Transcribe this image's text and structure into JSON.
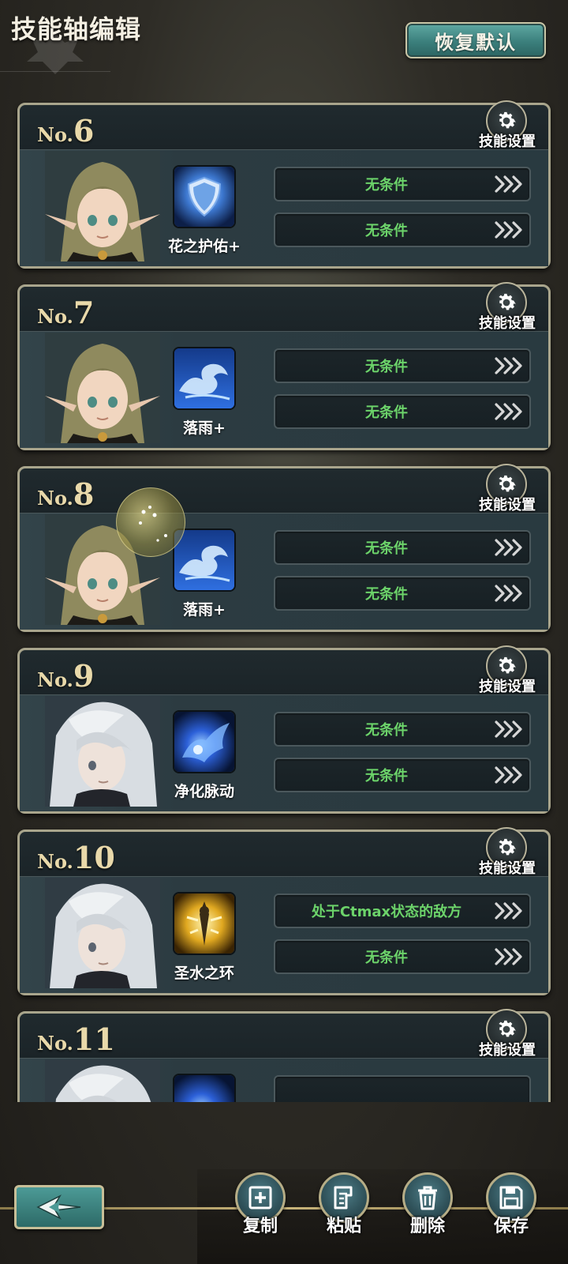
{
  "header": {
    "title": "技能轴编辑",
    "reset_label": "恢复默认"
  },
  "cards": [
    {
      "no_prefix": "No.",
      "number": "6",
      "settings_label": "技能设置",
      "skill_name": "花之护佑+",
      "cond1": "无条件",
      "cond2": "无条件",
      "character": "elf",
      "skill_icon": "shield-skill-icon"
    },
    {
      "no_prefix": "No.",
      "number": "7",
      "settings_label": "技能设置",
      "skill_name": "落雨+",
      "cond1": "无条件",
      "cond2": "无条件",
      "character": "elf",
      "skill_icon": "wave-skill-icon"
    },
    {
      "no_prefix": "No.",
      "number": "8",
      "settings_label": "技能设置",
      "skill_name": "落雨+",
      "cond1": "无条件",
      "cond2": "无条件",
      "character": "elf",
      "skill_icon": "wave-skill-icon"
    },
    {
      "no_prefix": "No.",
      "number": "9",
      "settings_label": "技能设置",
      "skill_name": "净化脉动",
      "cond1": "无条件",
      "cond2": "无条件",
      "character": "silver",
      "skill_icon": "pulse-skill-icon"
    },
    {
      "no_prefix": "No.",
      "number": "10",
      "settings_label": "技能设置",
      "skill_name": "圣水之环",
      "cond1": "处于Ctmax状态的敌方",
      "cond2": "无条件",
      "character": "silver",
      "skill_icon": "holy-skill-icon"
    },
    {
      "no_prefix": "No.",
      "number": "11",
      "settings_label": "技能设置",
      "skill_name": "",
      "cond1": "",
      "cond2": "",
      "character": "silver",
      "skill_icon": "pulse-skill-icon"
    }
  ],
  "bottom": {
    "copy_label": "复制",
    "paste_label": "粘贴",
    "delete_label": "删除",
    "save_label": "保存"
  },
  "colors": {
    "condition_text": "#6cd36a",
    "number_gold": "#e9d9aa",
    "button_teal": "#3b7f7c"
  }
}
